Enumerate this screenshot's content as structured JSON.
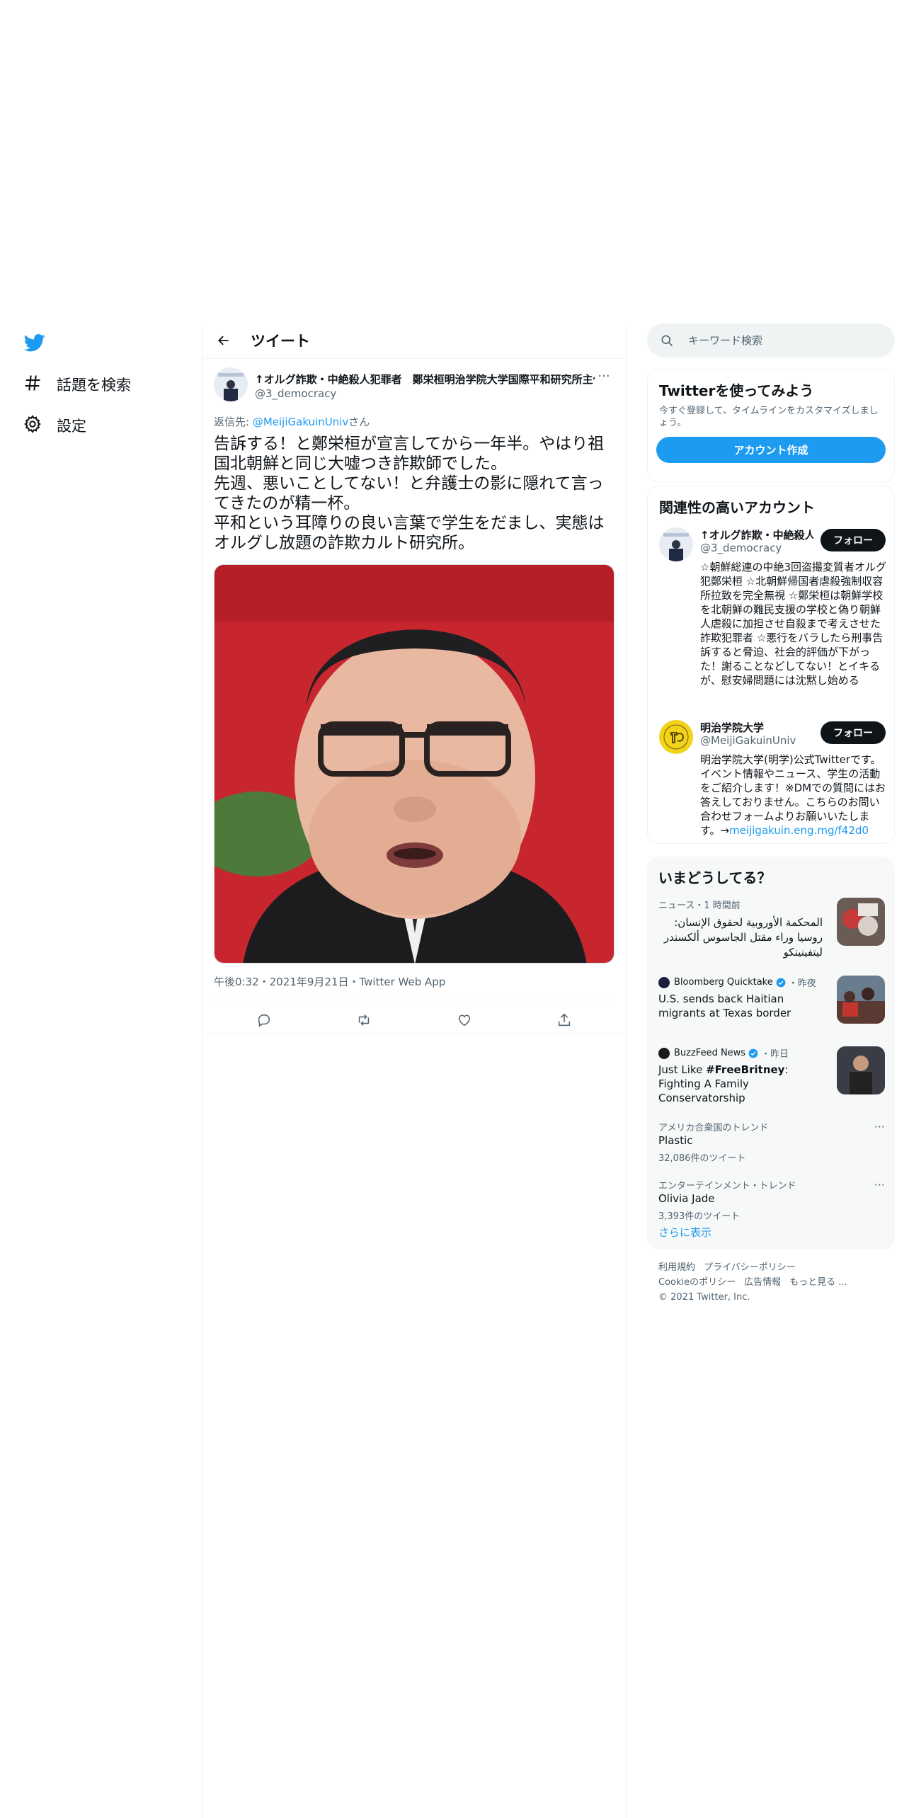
{
  "nav": {
    "items": [
      {
        "label": "話題を検索",
        "icon": "hashtag-icon"
      },
      {
        "label": "設定",
        "icon": "gear-icon"
      }
    ]
  },
  "header": {
    "title": "ツイート"
  },
  "tweet": {
    "author_name": "↑オルグ詐欺・中絶殺人犯罪者　鄭栄桓明治学院大学国際平和研究所主任",
    "author_handle": "@3_democracy",
    "reply_prefix": "返信先: ",
    "reply_handle": "@MeijiGakuinUniv",
    "reply_suffix": "さん",
    "text": "告訴する！と鄭栄桓が宣言してから一年半。やはり祖国北朝鮮と同じ大嘘つき詐欺師でした。\n先週、悪いことしてない！と弁護士の影に隠れて言ってきたのが精一杯。\n平和という耳障りの良い言葉で学生をだまし、実態はオルグし放題の詐欺カルト研究所。",
    "meta": "午後0:32・2021年9月21日・Twitter Web App"
  },
  "search": {
    "placeholder": "キーワード検索"
  },
  "signup": {
    "title": "Twitterを使ってみよう",
    "subtitle": "今すぐ登録して、タイムラインをカスタマイズしましょう。",
    "button": "アカウント作成"
  },
  "related": {
    "title": "関連性の高いアカウント",
    "accounts": [
      {
        "name": "↑オルグ詐欺・中絶殺人犯罪者",
        "handle": "@3_democracy",
        "follow": "フォロー",
        "bio": "☆朝鮮総連の中絶3回盗撮変質者オルグ犯鄭栄桓 ☆北朝鮮帰国者虐殺強制収容所拉致を完全無視 ☆鄭栄桓は朝鮮学校を北朝鮮の難民支援の学校と偽り朝鮮人虐殺に加担させ自殺まで考えさせた詐欺犯罪者 ☆悪行をバラしたら刑事告訴すると脅迫、社会的評価が下がった！謝ることなどしてない！とイキるが、慰安婦問題には沈黙し始める"
      },
      {
        "name": "明治学院大学",
        "handle": "@MeijiGakuinUniv",
        "follow": "フォロー",
        "bio": "明治学院大学(明学)公式Twitterです。イベント情報やニュース、学生の活動をご紹介します！※DMでの質問にはお答えしておりません。こちらのお問い合わせフォームよりお願いいたします。→",
        "bio_link": "meijigakuin.eng.mg/f42d0"
      }
    ]
  },
  "trends": {
    "title": "いまどうしてる？",
    "items": [
      {
        "meta": "ニュース・1 時間前",
        "title": "المحكمة الأوروبية لحقوق الإنسان: روسيا وراء مقتل الجاسوس ألكسندر ليتفينينكو"
      },
      {
        "source": "Bloomberg Quicktake",
        "when": "・昨夜",
        "title": "U.S. sends back Haitian migrants at Texas border"
      },
      {
        "source": "BuzzFeed News",
        "when": "・昨日",
        "title_pre": "Just Like ",
        "title_bold": "#FreeBritney",
        "title_post": ": Fighting A Family Conservatorship"
      },
      {
        "meta": "アメリカ合衆国のトレンド",
        "title": "Plastic",
        "count": "32,086件のツイート"
      },
      {
        "meta": "エンターテインメント・トレンド",
        "title": "Olivia Jade",
        "count": "3,393件のツイート"
      }
    ],
    "show_more": "さらに表示"
  },
  "footer": {
    "links": [
      "利用規約",
      "プライバシーポリシー",
      "Cookieのポリシー",
      "広告情報",
      "もっと見る ..."
    ],
    "copyright": "© 2021 Twitter, Inc."
  },
  "colors": {
    "accent": "#1d9bf0",
    "text": "#0f1419",
    "muted": "#536471"
  }
}
